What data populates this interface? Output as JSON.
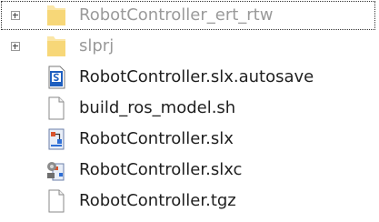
{
  "tree": {
    "items": [
      {
        "label": "RobotController_ert_rtw",
        "kind": "folder",
        "expandable": true,
        "selected": true
      },
      {
        "label": "slprj",
        "kind": "folder",
        "expandable": true,
        "selected": false
      },
      {
        "label": "RobotController.slx.autosave",
        "kind": "autosave-file",
        "expandable": false,
        "selected": false
      },
      {
        "label": "build_ros_model.sh",
        "kind": "blank-file",
        "expandable": false,
        "selected": false
      },
      {
        "label": "RobotController.slx",
        "kind": "simulink-model",
        "expandable": false,
        "selected": false
      },
      {
        "label": "RobotController.slxc",
        "kind": "simulink-cache",
        "expandable": false,
        "selected": false
      },
      {
        "label": "RobotController.tgz",
        "kind": "blank-file",
        "expandable": false,
        "selected": false
      }
    ]
  }
}
